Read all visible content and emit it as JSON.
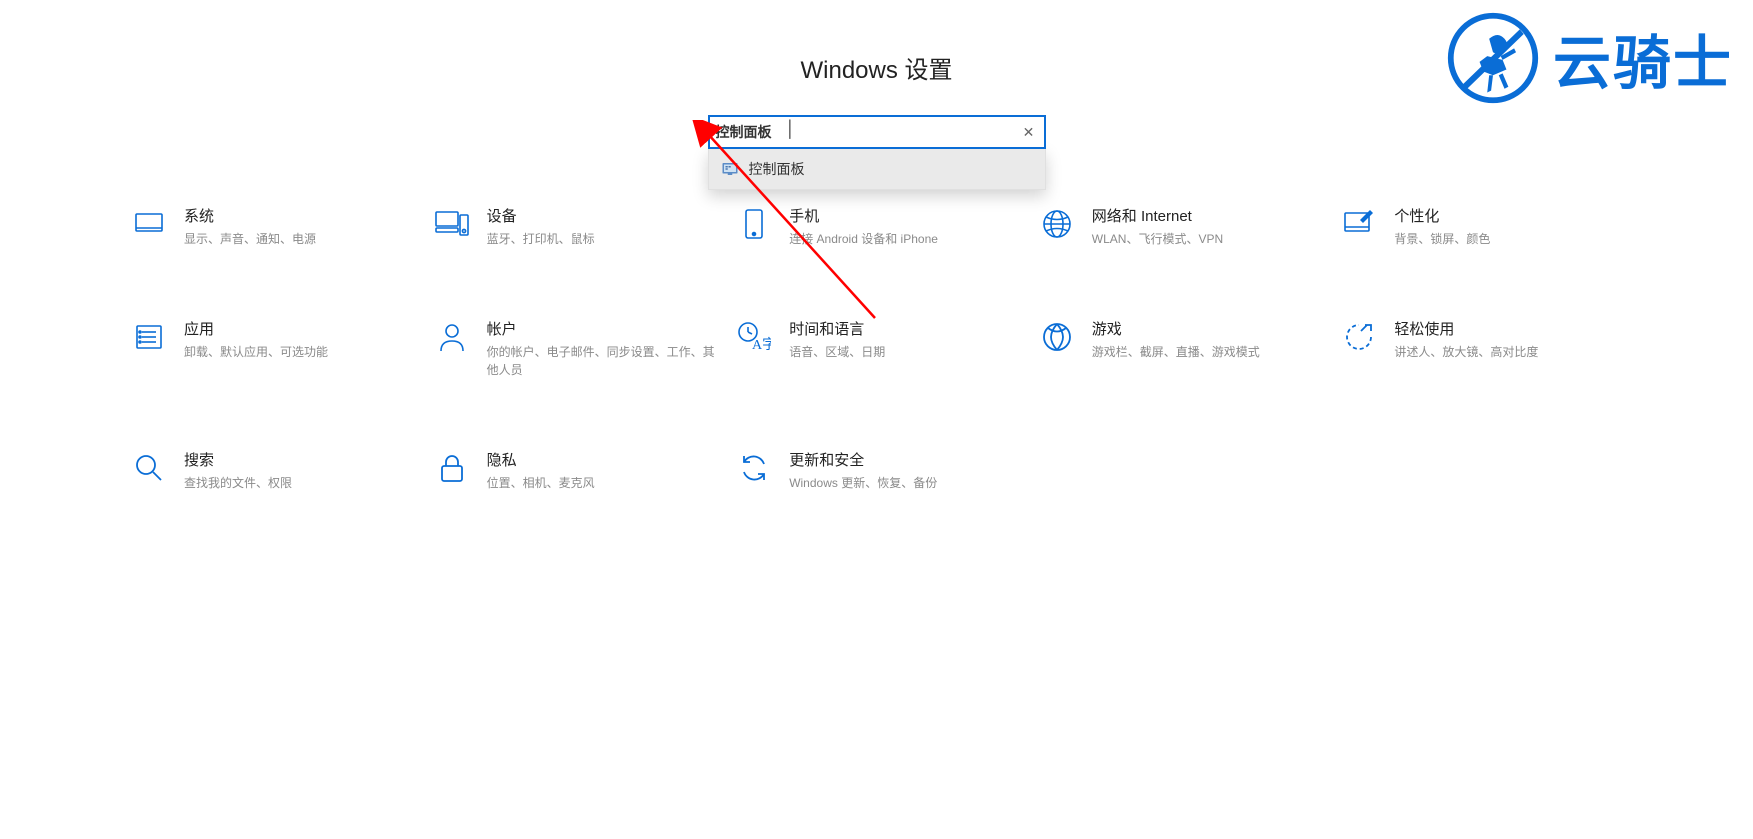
{
  "header": {
    "title": "Windows 设置"
  },
  "search": {
    "value": "控制面板",
    "suggestion": "控制面板"
  },
  "watermark": {
    "text": "云骑士"
  },
  "tiles": [
    {
      "icon": "system",
      "title": "系统",
      "desc": "显示、声音、通知、电源"
    },
    {
      "icon": "devices",
      "title": "设备",
      "desc": "蓝牙、打印机、鼠标"
    },
    {
      "icon": "phone",
      "title": "手机",
      "desc": "连接 Android 设备和 iPhone"
    },
    {
      "icon": "network",
      "title": "网络和 Internet",
      "desc": "WLAN、飞行模式、VPN"
    },
    {
      "icon": "personalize",
      "title": "个性化",
      "desc": "背景、锁屏、颜色"
    },
    {
      "icon": "apps",
      "title": "应用",
      "desc": "卸载、默认应用、可选功能"
    },
    {
      "icon": "accounts",
      "title": "帐户",
      "desc": "你的帐户、电子邮件、同步设置、工作、其他人员"
    },
    {
      "icon": "time",
      "title": "时间和语言",
      "desc": "语音、区域、日期"
    },
    {
      "icon": "gaming",
      "title": "游戏",
      "desc": "游戏栏、截屏、直播、游戏模式"
    },
    {
      "icon": "ease",
      "title": "轻松使用",
      "desc": "讲述人、放大镜、高对比度"
    },
    {
      "icon": "search",
      "title": "搜索",
      "desc": "查找我的文件、权限"
    },
    {
      "icon": "privacy",
      "title": "隐私",
      "desc": "位置、相机、麦克风"
    },
    {
      "icon": "update",
      "title": "更新和安全",
      "desc": "Windows 更新、恢复、备份"
    }
  ],
  "colors": {
    "accent": "#0a6dd6",
    "arrow": "#ff0000"
  }
}
